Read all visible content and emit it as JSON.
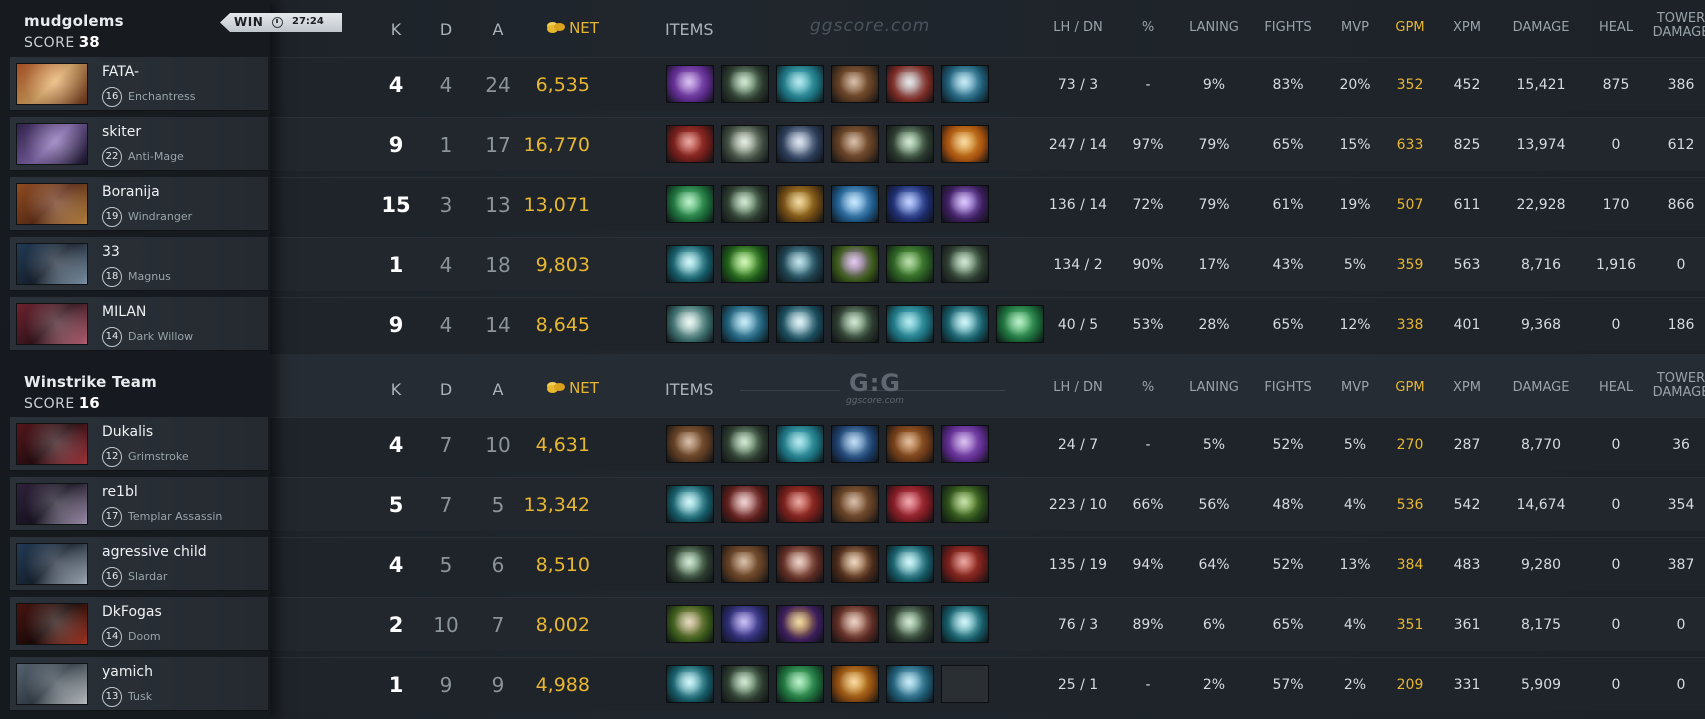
{
  "match": {
    "result": "WIN",
    "duration": "27:24",
    "watermark_top": "ggscore.com",
    "watermark_mid_logo": "G:G",
    "watermark_mid_text": "ggscore.com"
  },
  "headers": {
    "k": "K",
    "d": "D",
    "a": "A",
    "net": "NET",
    "items": "ITEMS",
    "lhdn": "LH  /  DN",
    "pct": "%",
    "laning": "LANING",
    "fights": "FIGHTS",
    "mvp": "MVP",
    "gpm": "GPM",
    "xpm": "XPM",
    "damage": "DAMAGE",
    "heal": "HEAL",
    "tower1": "TOWER",
    "tower2": "DAMAGE"
  },
  "teams": [
    {
      "name": "mudgolems",
      "score_label": "SCORE",
      "score": "38",
      "players": [
        {
          "name": "FATA-",
          "level": "16",
          "hero": "Enchantress",
          "portrait": [
            "#c9612b",
            "#7a3b1e",
            "#e9b26b"
          ],
          "k": "4",
          "d": "4",
          "a": "24",
          "net": "6,535",
          "lhdn": "73  /  3",
          "pct": "-",
          "laning": "9%",
          "fights": "83%",
          "mvp": "20%",
          "gpm": "352",
          "xpm": "452",
          "damage": "15,421",
          "heal": "875",
          "tower": "386",
          "items": [
            [
              "#5b2a8a",
              "#b07be0"
            ],
            [
              "#2c3a2f",
              "#9fcfa4"
            ],
            [
              "#1c6f7c",
              "#66d4e0"
            ],
            [
              "#5a3a22",
              "#a9764b"
            ],
            [
              "#7b2a23",
              "#c9cdd3"
            ],
            [
              "#1e5a73",
              "#8fd6ef"
            ]
          ]
        },
        {
          "name": "skiter",
          "level": "22",
          "hero": "Anti-Mage",
          "portrait": [
            "#3b2a5c",
            "#1b1730",
            "#8c6fb8"
          ],
          "k": "9",
          "d": "1",
          "a": "17",
          "net": "16,770",
          "lhdn": "247  /  14",
          "pct": "97%",
          "laning": "79%",
          "fights": "65%",
          "mvp": "15%",
          "gpm": "633",
          "xpm": "825",
          "damage": "13,974",
          "heal": "0",
          "tower": "612",
          "items": [
            [
              "#6e1d1a",
              "#d14a3c"
            ],
            [
              "#3e4a3f",
              "#c9d8c2"
            ],
            [
              "#2b3b56",
              "#b9c9e0"
            ],
            [
              "#5a3a22",
              "#a9764b"
            ],
            [
              "#2c3a2f",
              "#9fcfa4"
            ],
            [
              "#a4500f",
              "#f2b23b"
            ]
          ]
        },
        {
          "name": "Boranija",
          "level": "19",
          "hero": "Windranger",
          "portrait": [
            "#b4602a",
            "#e0a14d",
            "#6a3218"
          ],
          "k": "15",
          "d": "3",
          "a": "13",
          "net": "13,071",
          "lhdn": "136  /  14",
          "pct": "72%",
          "laning": "79%",
          "fights": "61%",
          "mvp": "19%",
          "gpm": "507",
          "xpm": "611",
          "damage": "22,928",
          "heal": "170",
          "tower": "866",
          "items": [
            [
              "#1c6b3a",
              "#6fe08e"
            ],
            [
              "#2c3a2f",
              "#9fcfa4"
            ],
            [
              "#6b4713",
              "#e0b040"
            ],
            [
              "#1f5a8a",
              "#8fd0ff"
            ],
            [
              "#1d2c6b",
              "#7fa0ff"
            ],
            [
              "#3b1e5c",
              "#b78cff"
            ]
          ]
        },
        {
          "name": "33",
          "level": "18",
          "hero": "Magnus",
          "portrait": [
            "#2a4a6a",
            "#9bb8cf",
            "#1a2535"
          ],
          "k": "1",
          "d": "4",
          "a": "18",
          "net": "9,803",
          "lhdn": "134  /  2",
          "pct": "90%",
          "laning": "17%",
          "fights": "43%",
          "mvp": "5%",
          "gpm": "359",
          "xpm": "563",
          "damage": "8,716",
          "heal": "1,916",
          "tower": "0",
          "items": [
            [
              "#155a66",
              "#a0eef5"
            ],
            [
              "#1f5a1a",
              "#9ff06b"
            ],
            [
              "#1d3f4c",
              "#7ec3d3"
            ],
            [
              "#3b5a1a",
              "#c28de0"
            ],
            [
              "#2a5a22",
              "#6dbb4f"
            ],
            [
              "#2c3a2f",
              "#9fcfa4"
            ]
          ]
        },
        {
          "name": "MILAN",
          "level": "14",
          "hero": "Dark Willow",
          "portrait": [
            "#8a2b3a",
            "#e0788f",
            "#3b1620"
          ],
          "k": "9",
          "d": "4",
          "a": "14",
          "net": "8,645",
          "lhdn": "40  /  5",
          "pct": "53%",
          "laning": "28%",
          "fights": "65%",
          "mvp": "12%",
          "gpm": "338",
          "xpm": "401",
          "damage": "9,368",
          "heal": "0",
          "tower": "186",
          "items": [
            [
              "#3a6a6a",
              "#d8f2ea"
            ],
            [
              "#1e5a73",
              "#8fd6ef"
            ],
            [
              "#1a4a5a",
              "#bfe8f2"
            ],
            [
              "#2c3a2f",
              "#9fcfa4"
            ],
            [
              "#1c6f7c",
              "#66d4e0"
            ],
            [
              "#155a66",
              "#a0eef5"
            ],
            [
              "#1c6b3a",
              "#6fe08e"
            ]
          ]
        }
      ]
    },
    {
      "name": "Winstrike Team",
      "score_label": "SCORE",
      "score": "16",
      "players": [
        {
          "name": "Dukalis",
          "level": "12",
          "hero": "Grimstroke",
          "portrait": [
            "#6a1d22",
            "#c9414a",
            "#2a0d12"
          ],
          "k": "4",
          "d": "7",
          "a": "10",
          "net": "4,631",
          "lhdn": "24  /  7",
          "pct": "-",
          "laning": "5%",
          "fights": "52%",
          "mvp": "5%",
          "gpm": "270",
          "xpm": "287",
          "damage": "8,770",
          "heal": "0",
          "tower": "36",
          "items": [
            [
              "#5a3a22",
              "#a9764b"
            ],
            [
              "#2c3a2f",
              "#9fcfa4"
            ],
            [
              "#1c6f7c",
              "#66d4e0"
            ],
            [
              "#1d3f6b",
              "#7fb8e8"
            ],
            [
              "#6b3a18",
              "#c47a38"
            ],
            [
              "#5b2a8a",
              "#b07be0"
            ]
          ]
        },
        {
          "name": "re1bl",
          "level": "17",
          "hero": "Templar Assassin",
          "portrait": [
            "#3b2a4a",
            "#c6b3d8",
            "#1a1525"
          ],
          "k": "5",
          "d": "7",
          "a": "5",
          "net": "13,342",
          "lhdn": "223  /  10",
          "pct": "66%",
          "laning": "56%",
          "fights": "48%",
          "mvp": "4%",
          "gpm": "536",
          "xpm": "542",
          "damage": "14,674",
          "heal": "0",
          "tower": "354",
          "items": [
            [
              "#155a66",
              "#a0eef5"
            ],
            [
              "#5a1d1a",
              "#e0a0a0"
            ],
            [
              "#6e1d1a",
              "#d14a3c"
            ],
            [
              "#5a3a22",
              "#a9764b"
            ],
            [
              "#7a1a22",
              "#e04a5a"
            ],
            [
              "#2a4a1a",
              "#8ac04a"
            ]
          ]
        },
        {
          "name": "agressive child",
          "level": "16",
          "hero": "Slardar",
          "portrait": [
            "#2a4a6a",
            "#c9d6e6",
            "#1a2535"
          ],
          "k": "4",
          "d": "5",
          "a": "6",
          "net": "8,510",
          "lhdn": "135  /  19",
          "pct": "94%",
          "laning": "64%",
          "fights": "52%",
          "mvp": "13%",
          "gpm": "384",
          "xpm": "483",
          "damage": "9,280",
          "heal": "0",
          "tower": "387",
          "items": [
            [
              "#2c3a2f",
              "#9fcfa4"
            ],
            [
              "#5a3a22",
              "#a9764b"
            ],
            [
              "#5a2a22",
              "#d8a08a"
            ],
            [
              "#4a2a1a",
              "#d8a878"
            ],
            [
              "#155a66",
              "#a0eef5"
            ],
            [
              "#6e1d1a",
              "#d14a3c"
            ]
          ]
        },
        {
          "name": "DkFogas",
          "level": "14",
          "hero": "Doom",
          "portrait": [
            "#5a1a14",
            "#c9412a",
            "#1e0a08"
          ],
          "k": "2",
          "d": "10",
          "a": "7",
          "net": "8,002",
          "lhdn": "76  /  3",
          "pct": "89%",
          "laning": "6%",
          "fights": "65%",
          "mvp": "4%",
          "gpm": "351",
          "xpm": "361",
          "damage": "8,175",
          "heal": "0",
          "tower": "0",
          "items": [
            [
              "#3a5a1a",
              "#c8b07a"
            ],
            [
              "#2a2a6a",
              "#8a7ae8"
            ],
            [
              "#3b1e5c",
              "#e0b040"
            ],
            [
              "#5a2a22",
              "#d8a08a"
            ],
            [
              "#2c3a2f",
              "#9fcfa4"
            ],
            [
              "#155a66",
              "#a0eef5"
            ]
          ]
        },
        {
          "name": "yamich",
          "level": "13",
          "hero": "Tusk",
          "portrait": [
            "#6a7a8a",
            "#e6ecf0",
            "#3a4550"
          ],
          "k": "1",
          "d": "9",
          "a": "9",
          "net": "4,988",
          "lhdn": "25  /  1",
          "pct": "-",
          "laning": "2%",
          "fights": "57%",
          "mvp": "2%",
          "gpm": "209",
          "xpm": "331",
          "damage": "5,909",
          "heal": "0",
          "tower": "0",
          "items": [
            [
              "#155a66",
              "#a0eef5"
            ],
            [
              "#2c3a2f",
              "#9fcfa4"
            ],
            [
              "#1c6b3a",
              "#6fe08e"
            ],
            [
              "#8a4a10",
              "#f0b03a"
            ],
            [
              "#1e5a73",
              "#8fd6ef"
            ],
            null
          ]
        }
      ]
    }
  ]
}
